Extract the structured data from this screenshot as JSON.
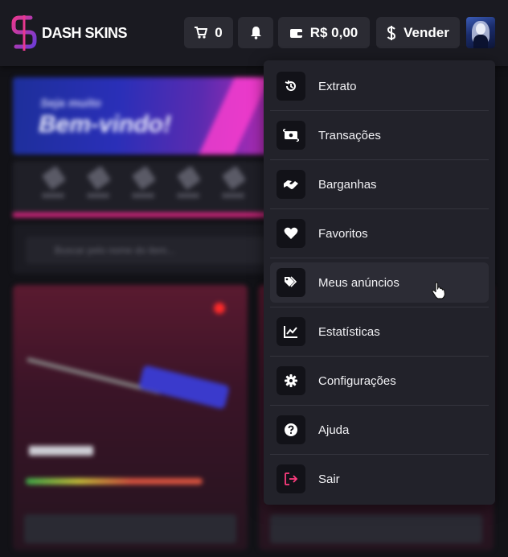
{
  "app": {
    "name": "DASH SKINS"
  },
  "header": {
    "cart_count": "0",
    "balance": "R$ 0,00",
    "sell_label": "Vender"
  },
  "background": {
    "banner_small": "Seja muito",
    "banner_big": "Bem-vindo!",
    "search_placeholder": "Buscar pelo nome do item..."
  },
  "menu": {
    "items": [
      {
        "label": "Extrato",
        "icon": "history-icon"
      },
      {
        "label": "Transações",
        "icon": "money-transfer-icon"
      },
      {
        "label": "Barganhas",
        "icon": "handshake-icon"
      },
      {
        "label": "Favoritos",
        "icon": "heart-icon"
      },
      {
        "label": "Meus anúncios",
        "icon": "tags-icon"
      },
      {
        "label": "Estatísticas",
        "icon": "chart-line-icon"
      },
      {
        "label": "Configurações",
        "icon": "gear-icon"
      },
      {
        "label": "Ajuda",
        "icon": "question-circle-icon"
      },
      {
        "label": "Sair",
        "icon": "sign-out-icon"
      }
    ],
    "hovered_index": 4
  },
  "colors": {
    "brand_pink": "#e7388f",
    "brand_purple": "#6c3bd6",
    "topbar_bg": "#1a1a21",
    "menu_bg": "#22222a",
    "logout_icon": "#ff3d7f"
  }
}
